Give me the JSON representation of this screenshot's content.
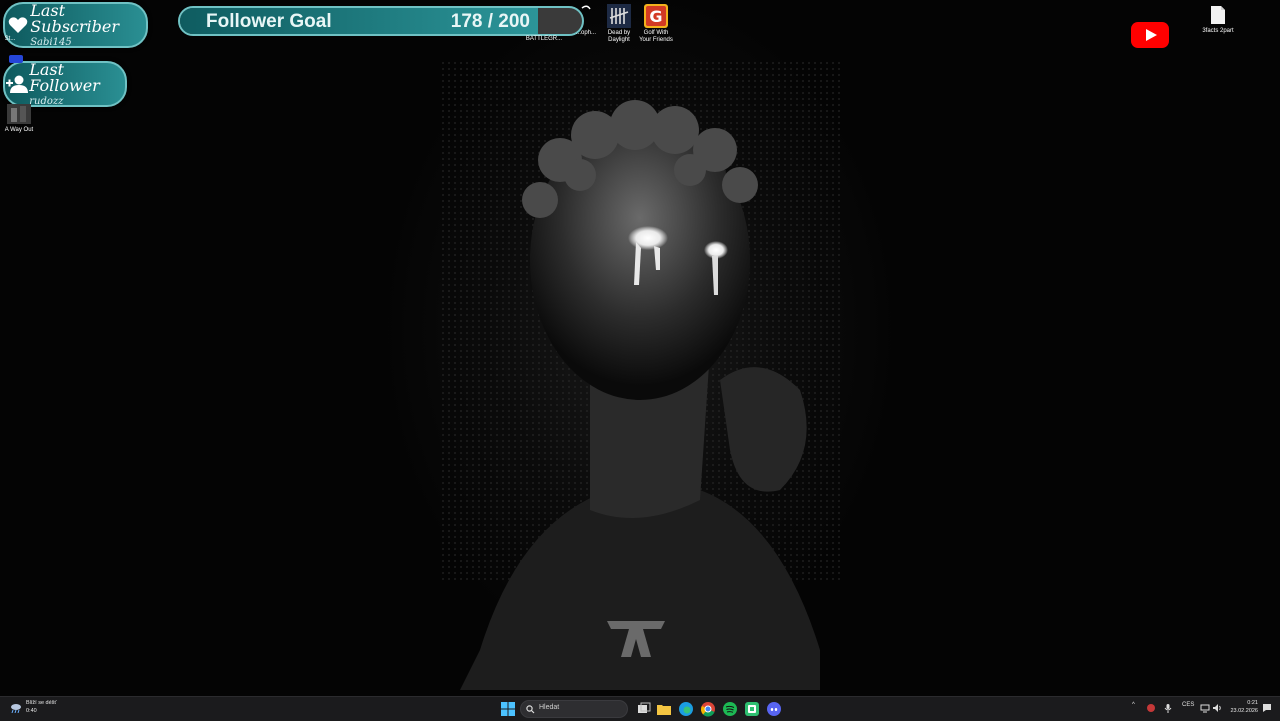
{
  "overlays": {
    "subscriber": {
      "title": "Last Subscriber",
      "name": "Sabi145"
    },
    "follower": {
      "title": "Last Follower",
      "name": "rudozz"
    },
    "follower_goal": {
      "label": "Follower Goal",
      "current": 178,
      "target": 200,
      "count_text": "178 / 200",
      "progress": 0.89
    }
  },
  "desktop_icons": {
    "left_partial": "St...",
    "a_way_out": "A Way Out",
    "battlegrounds": "BATTLEGR...",
    "ophan_partial": "...oph...",
    "dead_by_daylight": "Dead by Daylight",
    "golf": "Golf With Your Friends",
    "youtube": "youtube-icon",
    "file": "3facts 2part"
  },
  "taskbar": {
    "weather_line1": "Blíží se déšť",
    "weather_line2": "0:40",
    "search_placeholder": "Hledat",
    "language": "CES",
    "time": "0:21",
    "date": "23.02.2026"
  },
  "colors": {
    "overlay_teal": "#2a8f93",
    "overlay_border": "#6fc2c4",
    "taskbar_bg": "#1b1b1d"
  }
}
